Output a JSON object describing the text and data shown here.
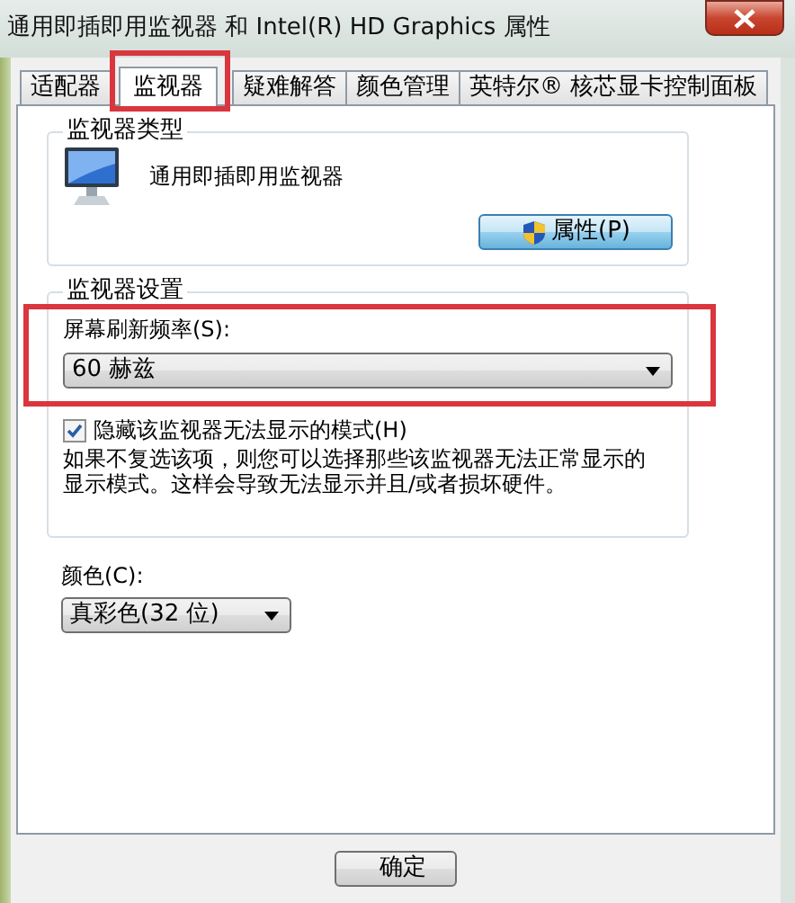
{
  "window": {
    "title": "通用即插即用监视器 和 Intel(R) HD Graphics 属性"
  },
  "tabs": [
    {
      "label": "适配器",
      "selected": false,
      "highlighted": false
    },
    {
      "label": "监视器",
      "selected": true,
      "highlighted": true
    },
    {
      "label": "疑难解答",
      "selected": false,
      "highlighted": false
    },
    {
      "label": "颜色管理",
      "selected": false,
      "highlighted": false
    },
    {
      "label": "英特尔® 核芯显卡控制面板",
      "selected": false,
      "highlighted": false
    }
  ],
  "monitor_type": {
    "title": "监视器类型",
    "name": "通用即插即用监视器",
    "button": "属性(P)"
  },
  "monitor_settings": {
    "title": "监视器设置",
    "refresh_rate": {
      "label": "屏幕刷新频率(S):",
      "value": "60 赫兹",
      "highlighted": true
    },
    "hide_modes": {
      "label": "隐藏该监视器无法显示的模式(H)",
      "checked": true
    },
    "note": "如果不复选该项，则您可以选择那些该监视器无法正常显示的显示模式。这样会导致无法显示并且/或者损坏硬件。"
  },
  "color": {
    "label": "颜色(C):",
    "value": "真彩色(32 位)"
  },
  "buttons": [
    "确定"
  ]
}
